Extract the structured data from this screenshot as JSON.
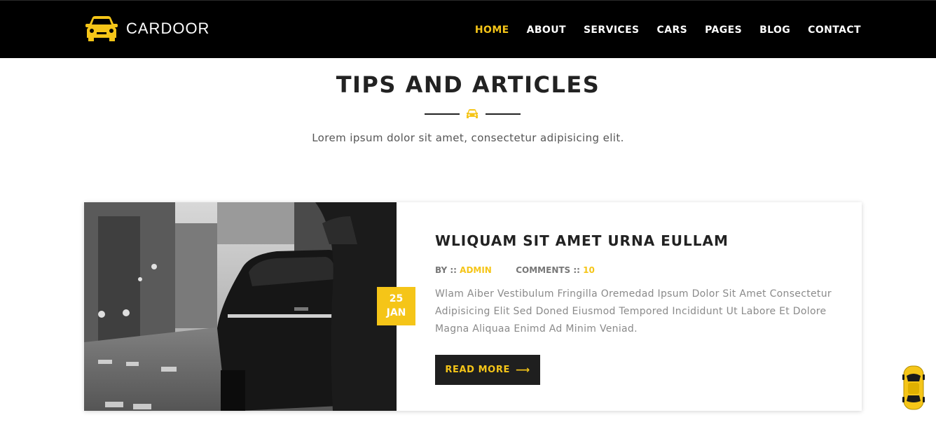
{
  "header": {
    "logo_text": "CARDOOR",
    "nav": [
      "HOME",
      "ABOUT",
      "SERVICES",
      "CARS",
      "PAGES",
      "BLOG",
      "CONTACT"
    ],
    "active_nav": "HOME"
  },
  "section": {
    "title": "TIPS AND ARTICLES",
    "subtitle": "Lorem ipsum dolor sit amet, consectetur adipisicing elit."
  },
  "article": {
    "date_day": "25",
    "date_month": "JAN",
    "title": "WLIQUAM SIT AMET URNA EULLAM",
    "by_label": "BY ::",
    "author": "ADMIN",
    "comments_label": "COMMENTS ::",
    "comments_count": "10",
    "excerpt": "Wlam Aiber Vestibulum Fringilla Oremedad Ipsum Dolor Sit Amet Consectetur Adipisicing Elit Sed Doned Eiusmod Tempored Incididunt Ut Labore Et Dolore Magna Aliquaa Enimd Ad Minim Veniad.",
    "read_more_label": "READ MORE",
    "read_more_arrow": "⟶"
  },
  "icons": {
    "logo": "car-front-icon",
    "divider": "car-icon",
    "scroll_top": "car-top-view-icon",
    "read_more": "arrow-right-icon"
  },
  "colors": {
    "accent": "#f5c518",
    "header_bg": "#000000",
    "dark": "#222222",
    "button_bg": "#1f1f1f"
  }
}
